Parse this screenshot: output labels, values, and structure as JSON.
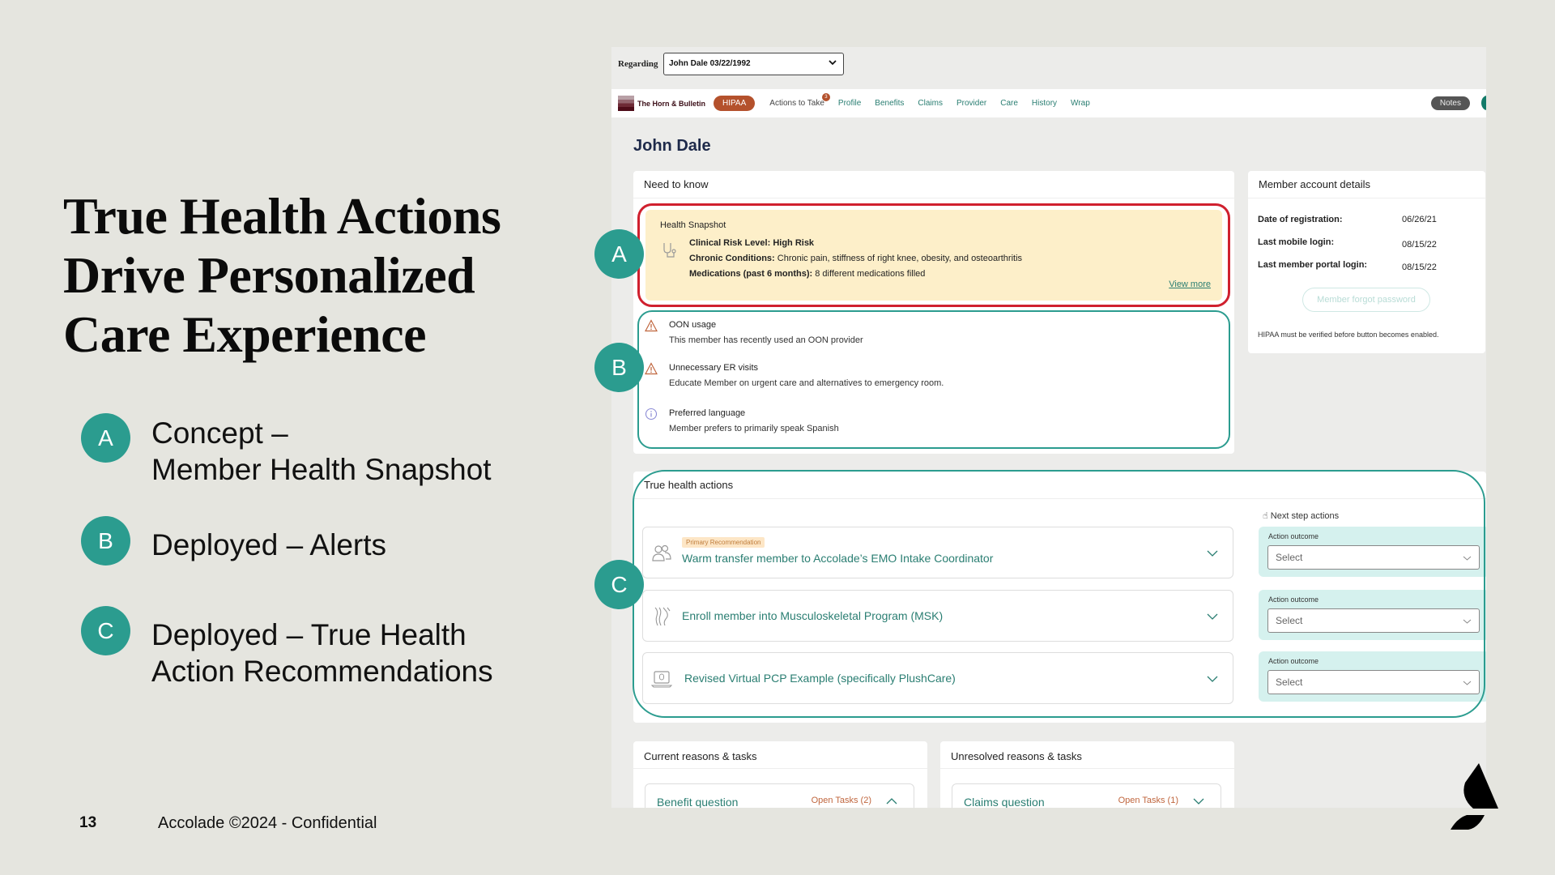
{
  "slide": {
    "title_lines": [
      "True Health Actions",
      "Drive Personalized",
      "Care Experience"
    ],
    "legend": [
      {
        "badge": "A",
        "line1": "Concept –",
        "line2": "Member Health Snapshot"
      },
      {
        "badge": "B",
        "line1": "Deployed – Alerts",
        "line2": ""
      },
      {
        "badge": "C",
        "line1": "Deployed – True Health",
        "line2": "Action Recommendations"
      }
    ],
    "page_number": "13",
    "footer": "Accolade ©2024 - Confidential"
  },
  "app": {
    "regarding": {
      "label": "Regarding",
      "value": "John Dale 03/22/1992"
    },
    "nav": {
      "brand": "The Horn & Bulletin",
      "hipaa": "HIPAA",
      "actions_to_take": "Actions to Take",
      "actions_badge": "3",
      "links": [
        "Profile",
        "Benefits",
        "Claims",
        "Provider",
        "Care",
        "History",
        "Wrap"
      ],
      "notes": "Notes"
    },
    "member_name": "John Dale",
    "need_to_know": {
      "title": "Need to know",
      "snapshot": {
        "title": "Health Snapshot",
        "risk_label": "Clinical Risk Level: High Risk",
        "conditions_label": "Chronic Conditions:",
        "conditions_value": "Chronic pain, stiffness of right knee, obesity, and osteoarthritis",
        "meds_label": "Medications (past 6 months):",
        "meds_value": "8 different medications filled",
        "view_more": "View more"
      },
      "alerts": [
        {
          "icon": "warning-icon",
          "title": "OON usage",
          "desc": "This member has recently used an OON provider"
        },
        {
          "icon": "warning-icon",
          "title": "Unnecessary ER visits",
          "desc": "Educate Member on urgent care and alternatives to emergency room."
        },
        {
          "icon": "info-icon",
          "title": "Preferred language",
          "desc": "Member prefers to primarily speak Spanish"
        }
      ]
    },
    "account": {
      "title": "Member account details",
      "rows": [
        {
          "label": "Date of registration:",
          "value": "06/26/21"
        },
        {
          "label": "Last mobile login:",
          "value": "08/15/22"
        },
        {
          "label": "Last member portal login:",
          "value": "08/15/22"
        }
      ],
      "forgot_button": "Member forgot password",
      "note": "HIPAA must be verified before button becomes enabled."
    },
    "true_health_actions": {
      "title": "True health actions",
      "next_steps_label": "Next step actions",
      "actions": [
        {
          "tag": "Primary Recommendation",
          "label": "Warm transfer member to Accolade’s EMO Intake Coordinator",
          "outcome_label": "Action outcome",
          "outcome_value": "Select"
        },
        {
          "tag": "",
          "label": "Enroll member into Musculoskeletal Program (MSK)",
          "outcome_label": "Action outcome",
          "outcome_value": "Select"
        },
        {
          "tag": "",
          "label": "Revised Virtual PCP Example (specifically PlushCare)",
          "outcome_label": "Action outcome",
          "outcome_value": "Select"
        }
      ]
    },
    "current_tasks": {
      "title": "Current reasons & tasks",
      "item": "Benefit question",
      "open": "Open Tasks (2)"
    },
    "unresolved_tasks": {
      "title": "Unresolved reasons & tasks",
      "item": "Claims question",
      "open": "Open Tasks (1)"
    },
    "annotations": [
      "A",
      "B",
      "C"
    ]
  },
  "colors": {
    "teal": "#2b9c8f",
    "alert_red": "#d0202e",
    "hipaa": "#b4512c",
    "snapshot_bg": "#fdefc9",
    "outcome_bg": "#d5f1ee"
  }
}
